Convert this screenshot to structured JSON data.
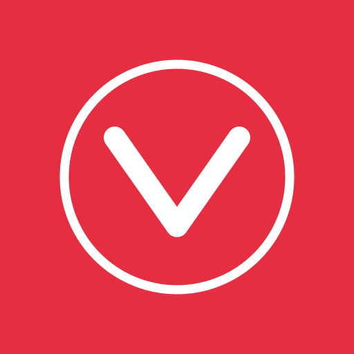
{
  "logo": {
    "icon": "v-chevron-circle-icon",
    "background_color": "#e62e42",
    "foreground_color": "#ffffff"
  }
}
